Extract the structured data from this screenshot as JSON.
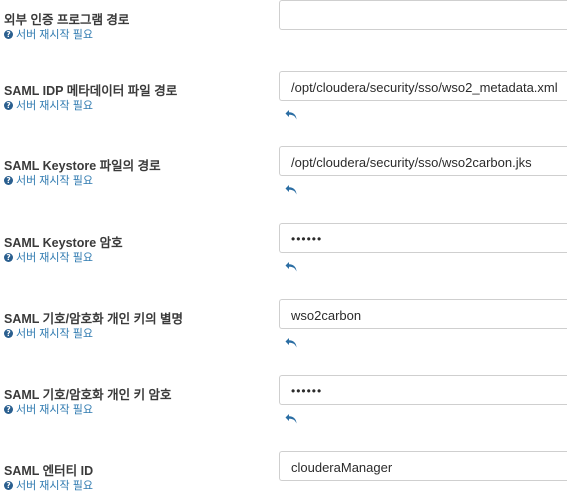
{
  "restart_note": "서버 재시작 필요",
  "rows": [
    {
      "label": "외부 인증 프로그램 경로",
      "value": ""
    },
    {
      "label": "SAML IDP 메타데이터 파일 경로",
      "value": "/opt/cloudera/security/sso/wso2_metadata.xml"
    },
    {
      "label": "SAML Keystore 파일의 경로",
      "value": "/opt/cloudera/security/sso/wso2carbon.jks"
    },
    {
      "label": "SAML Keystore 암호",
      "value": "••••••"
    },
    {
      "label": "SAML 기호/암호화 개인 키의 별명",
      "value": "wso2carbon"
    },
    {
      "label": "SAML 기호/암호화 개인 키 암호",
      "value": "••••••"
    },
    {
      "label": "SAML 엔터티 ID",
      "value": "clouderaManager"
    }
  ],
  "icons": {
    "help": "question-circle-icon",
    "undo": "undo-arrow-icon"
  },
  "colors": {
    "link": "#2f7ab0",
    "undo": "#2a6da3",
    "label": "#3a3a3a",
    "border": "#cfcfcf"
  }
}
